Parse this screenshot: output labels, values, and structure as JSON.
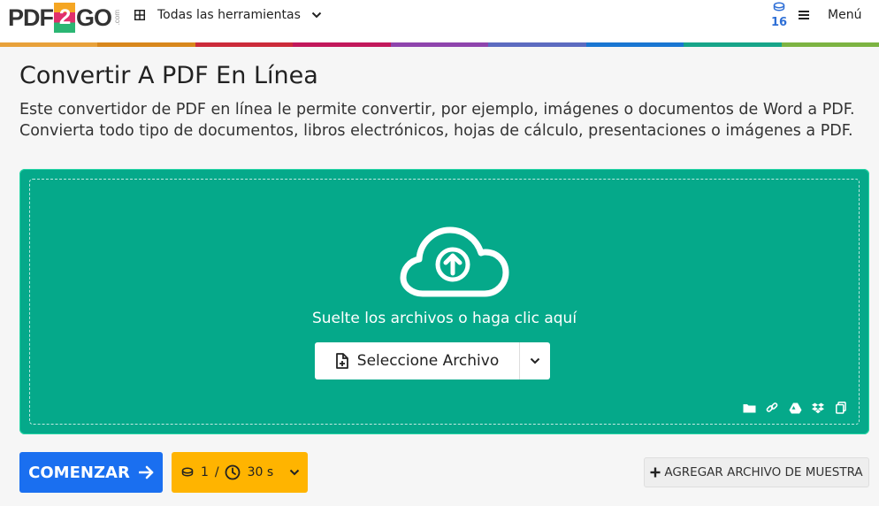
{
  "header": {
    "logo": {
      "part1": "PDF",
      "part2": "2",
      "part3": "GO",
      "suffix": ".com"
    },
    "tools_label": "Todas las herramientas",
    "credits": "16",
    "menu_label": "Menú",
    "stripe_colors": [
      "#e8a13a",
      "#d8871c",
      "#cc2b3a",
      "#c2185b",
      "#8e44ad",
      "#5c6bc0",
      "#1976d2",
      "#17a589",
      "#7cb342"
    ]
  },
  "page": {
    "title": "Convertir A PDF En Línea",
    "description": "Este convertidor de PDF en línea le permite convertir, por ejemplo, imágenes o documentos de Word a PDF. Convierta todo tipo de documentos, libros electrónicos, hojas de cálculo, presentaciones o imágenes a PDF."
  },
  "dropzone": {
    "drop_text": "Suelte los archivos o haga clic aquí",
    "select_label": "Seleccione Archivo",
    "sources": [
      "folder-icon",
      "link-icon",
      "google-drive-icon",
      "dropbox-icon",
      "clipboard-icon"
    ],
    "bg_color": "#05a98a"
  },
  "actions": {
    "start_label": "COMENZAR",
    "cost_credits": "1",
    "cost_sep": "/",
    "cost_time": "30 s",
    "sample_label": "AGREGAR ARCHIVO DE MUESTRA"
  }
}
